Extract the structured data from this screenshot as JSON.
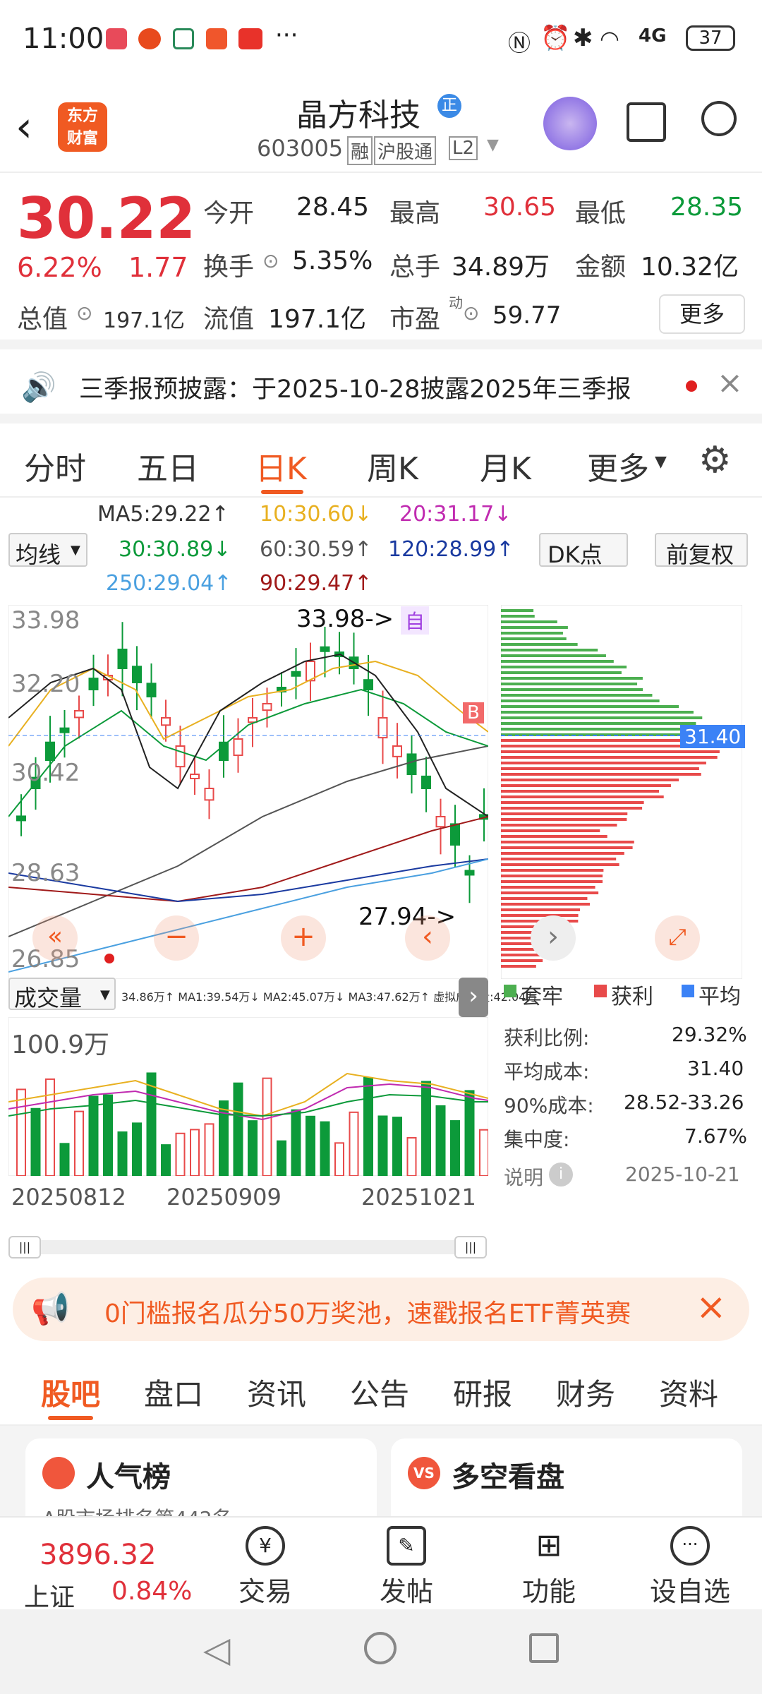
{
  "status": {
    "time": "11:00",
    "battery": "37",
    "network": "4G"
  },
  "header": {
    "app_logo_line1": "东方",
    "app_logo_line2": "财富",
    "stock_name": "晶方科技",
    "stock_badge": "正",
    "code": "603005",
    "tag_rong": "融",
    "tag_hgt": "沪股通",
    "tag_l2": "L2"
  },
  "quote": {
    "price": "30.22",
    "pct": "6.22%",
    "chg": "1.77",
    "open_label": "今开",
    "open": "28.45",
    "high_label": "最高",
    "high": "30.65",
    "low_label": "最低",
    "low": "28.35",
    "turnover_label": "换手",
    "turnover": "5.35%",
    "vol_label": "总手",
    "vol": "34.89万",
    "amount_label": "金额",
    "amount": "10.32亿",
    "mktcap_label": "总值",
    "mktcap": "197.1亿",
    "float_label": "流值",
    "float": "197.1亿",
    "pe_label": "市盈",
    "pe_sup": "动",
    "pe": "59.77",
    "more": "更多"
  },
  "notice": {
    "text": "三季报预披露：于2025-10-28披露2025年三季报"
  },
  "ktabs": [
    "分时",
    "五日",
    "日K",
    "周K",
    "月K",
    "更多"
  ],
  "ma": {
    "selector": "均线",
    "ma5": "MA5:29.22↑",
    "ma10": "10:30.60↓",
    "ma20": "20:31.17↓",
    "ma30": "30:30.89↓",
    "ma60": "60:30.59↑",
    "ma120": "120:28.99↑",
    "ma250": "250:29.04↑",
    "ma90": "90:29.47↑",
    "dk": "DK点",
    "fq": "前复权"
  },
  "kchart": {
    "y_labels": [
      "33.98",
      "32.20",
      "30.42",
      "28.63",
      "26.85"
    ],
    "high_note": "33.98->",
    "low_note": "27.94->",
    "self_tag": "自",
    "b_tag": "B"
  },
  "volume": {
    "selector": "成交量",
    "legend": "34.86万↑ MA1:39.54万↓ MA2:45.07万↓ MA3:47.62万↑ 虚拟成交量:42.04万",
    "max": "100.9万",
    "dates": [
      "20250812",
      "20250909",
      "20251021"
    ]
  },
  "chips": {
    "price_tag": "31.40",
    "legend_trapped": "套牢",
    "legend_profit": "获利",
    "legend_avg": "平均",
    "rows": [
      {
        "k": "获利比例:",
        "v": "29.32%"
      },
      {
        "k": "平均成本:",
        "v": "31.40"
      },
      {
        "k": "90%成本:",
        "v": "28.52-33.26"
      },
      {
        "k": "集中度:",
        "v": "7.67%"
      }
    ],
    "note": "说明",
    "date": "2025-10-21"
  },
  "banner": {
    "text": "0门槛报名瓜分50万奖池，速戳报名ETF菁英赛"
  },
  "bottom_tabs": [
    "股吧",
    "盘口",
    "资讯",
    "公告",
    "研报",
    "财务",
    "资料"
  ],
  "cards": {
    "left": "人气榜",
    "left_sub": "A股市场排名第442名",
    "right": "多空看盘"
  },
  "tabbar": {
    "index_val": "3896.32",
    "index_name": "上证",
    "index_pct": "0.84%",
    "trade": "交易",
    "post": "发帖",
    "func": "功能",
    "watch": "设自选"
  },
  "chart_data": {
    "type": "table",
    "price_axis": [
      33.98,
      32.2,
      30.42,
      28.63,
      26.85
    ],
    "highest": 33.98,
    "lowest": 27.94,
    "avg_cost": 31.4
  }
}
